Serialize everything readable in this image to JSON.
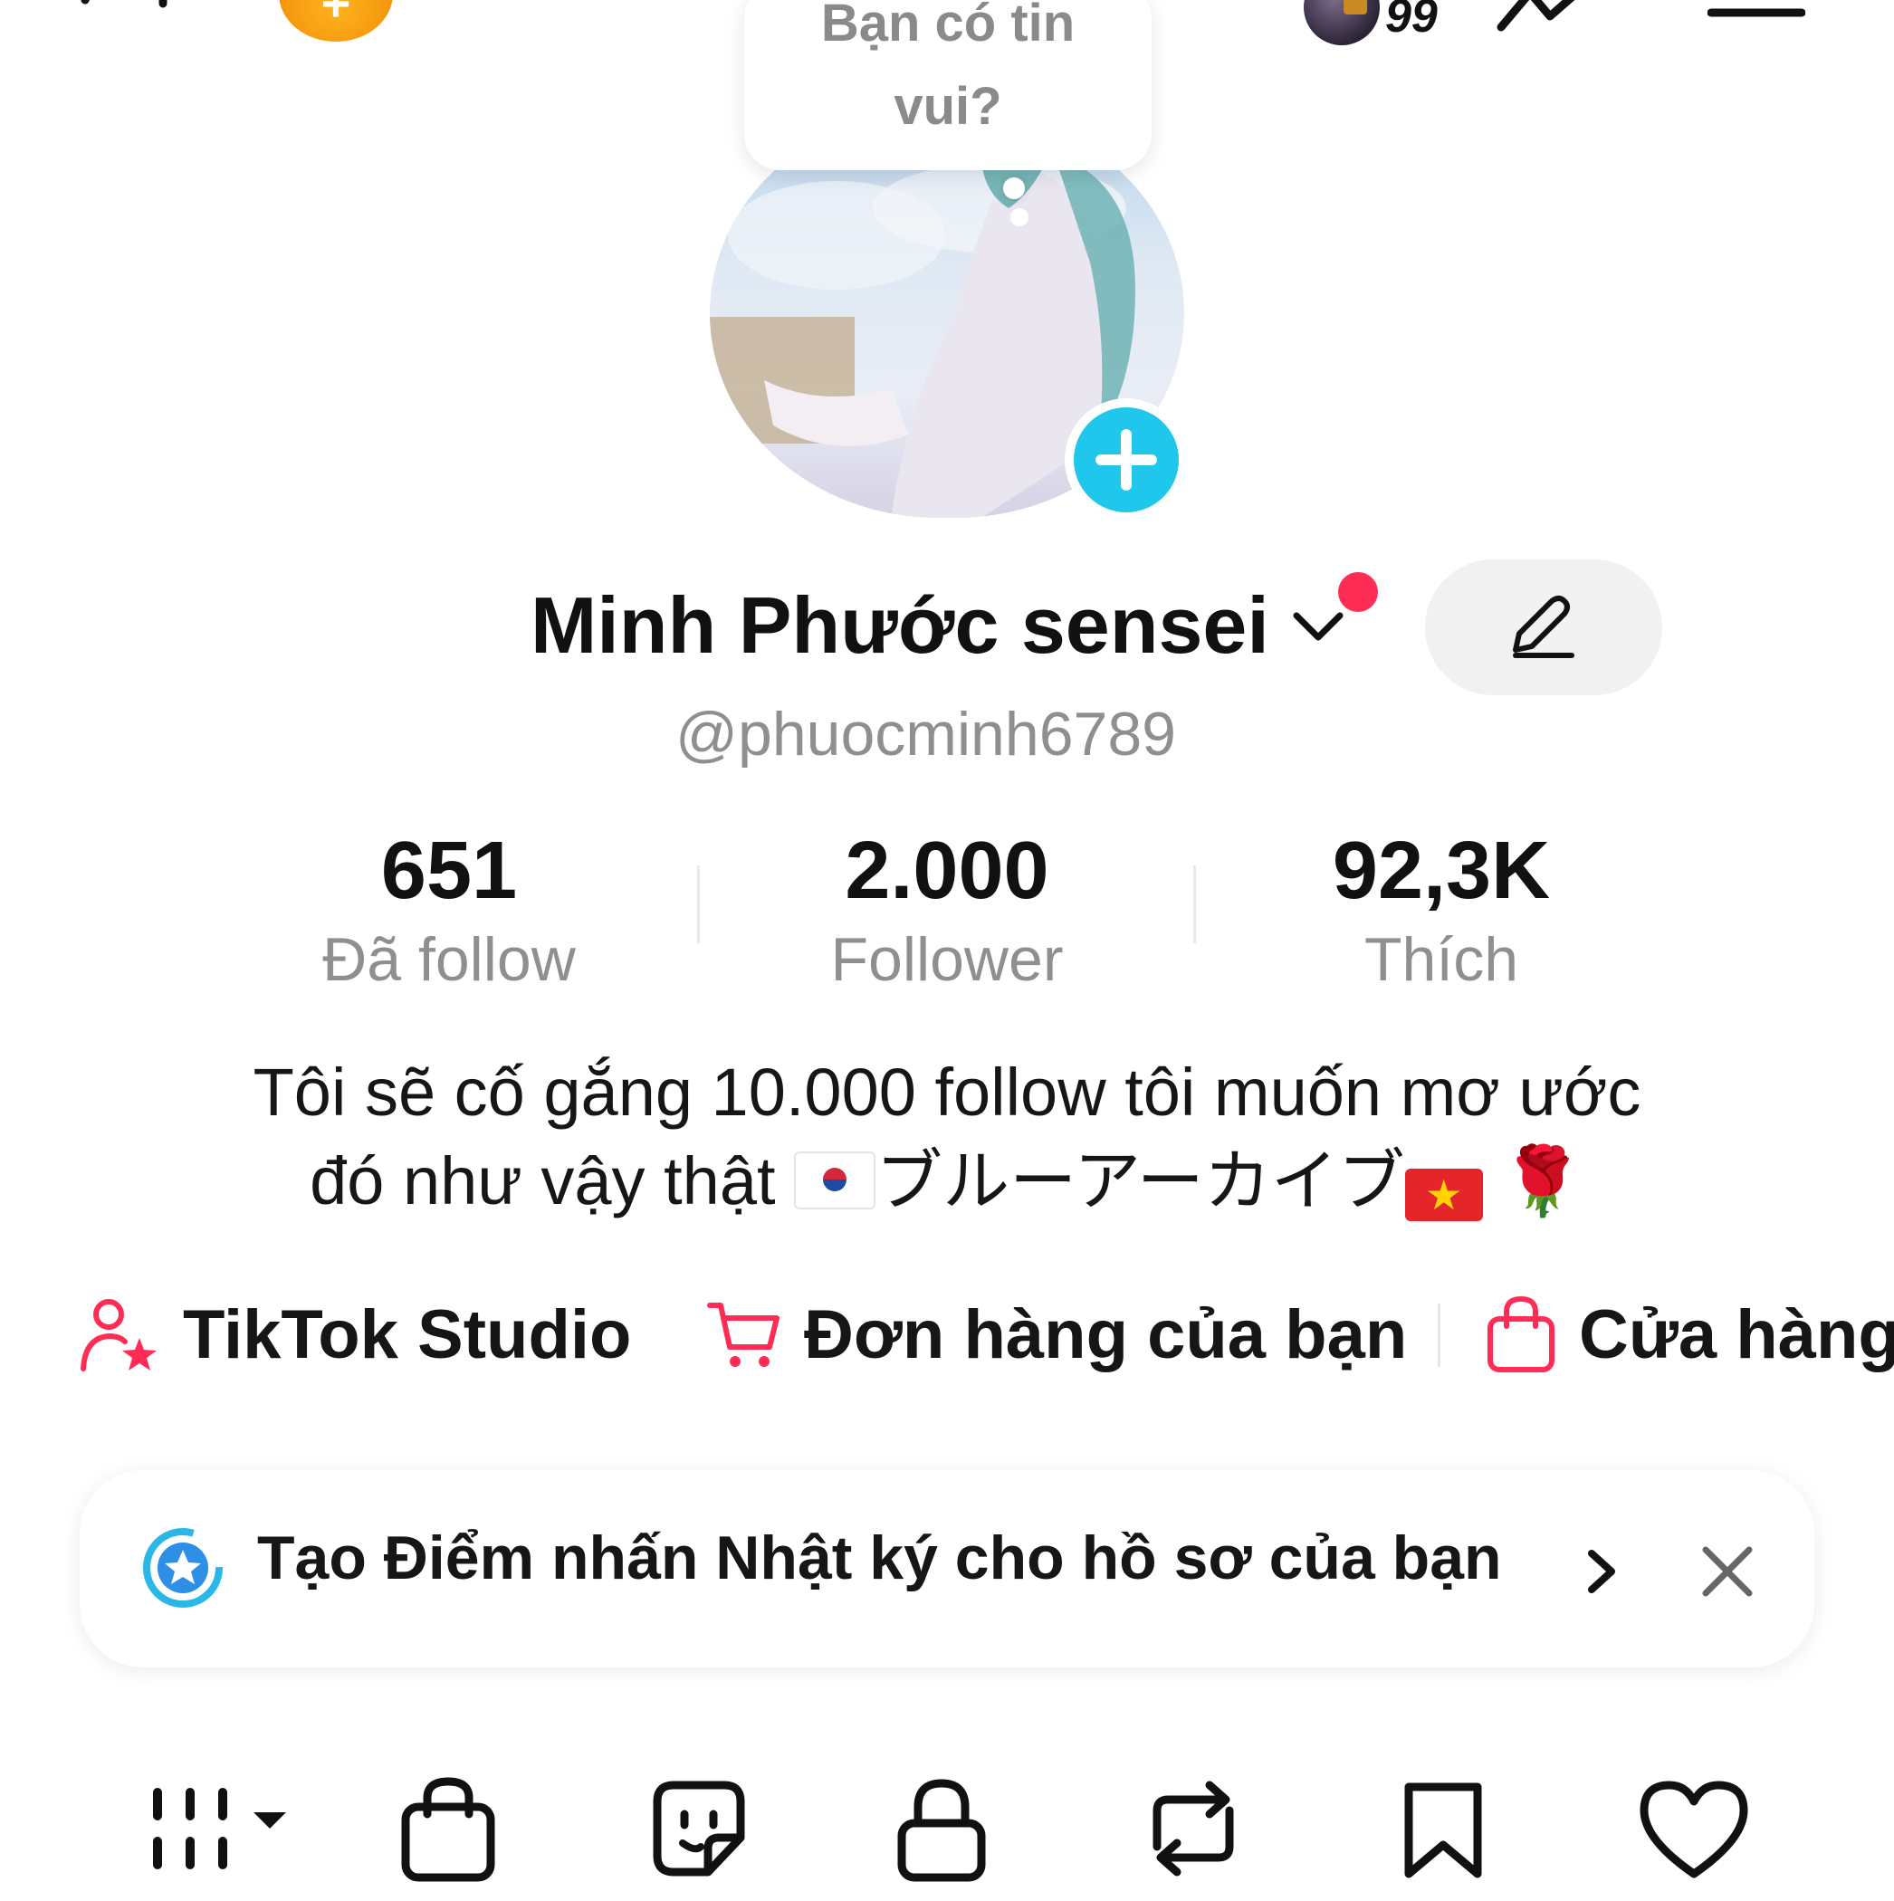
{
  "bubble": {
    "text_line1": "Bạn có tin",
    "text_line2": "vui?"
  },
  "topbar": {
    "badge_count": "99",
    "coin_symbol": "+"
  },
  "profile": {
    "name": "Minh Phước sensei",
    "username": "@phuocminh6789",
    "stats": [
      {
        "value": "651",
        "label": "Đã follow"
      },
      {
        "value": "2.000",
        "label": "Follower"
      },
      {
        "value": "92,3K",
        "label": "Thích"
      }
    ],
    "bio_line1": "Tôi sẽ cố gắng 10.000 follow tôi muốn mơ ước",
    "bio_line2_text": "đó như vậy thật ",
    "bio_japanese": "ブルーアーカイブ",
    "rose": "🌹",
    "vn_star": "★"
  },
  "links": [
    {
      "label": "TikTok Studio",
      "icon": "person-star-icon"
    },
    {
      "label": "Đơn hàng của bạn",
      "icon": "cart-icon"
    },
    {
      "label": "Cửa hàng",
      "icon": "shopping-bag-icon"
    }
  ],
  "highlight_card": {
    "text": "Tạo Điểm nhấn Nhật ký cho hồ sơ của bạn"
  },
  "tabs": [
    "grid-icon",
    "shop-bag-icon",
    "sticker-icon",
    "lock-icon",
    "repost-icon",
    "bookmark-icon",
    "heart-icon"
  ],
  "colors": {
    "accent": "#ff2d55",
    "plus_button": "#20c7ec",
    "coin": "#f59a10"
  }
}
